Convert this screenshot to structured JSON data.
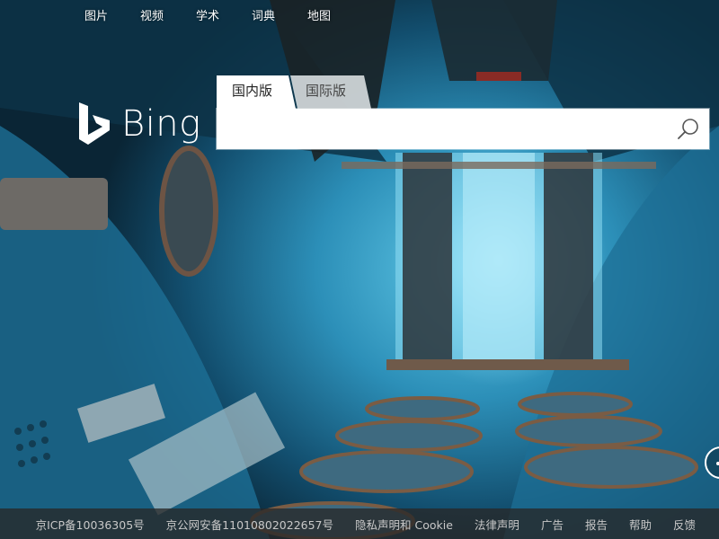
{
  "nav": {
    "items": [
      "图片",
      "视频",
      "学术",
      "词典",
      "地图"
    ]
  },
  "logo": {
    "text": "Bing"
  },
  "search": {
    "tabs": [
      "国内版",
      "国际版"
    ],
    "active_tab": "国内版",
    "value": "",
    "placeholder": ""
  },
  "footer": {
    "links": [
      "京ICP备10036305号",
      "京公网安备11010802022657号",
      "隐私声明和 Cookie",
      "法律声明",
      "广告",
      "报告",
      "帮助",
      "反馈"
    ]
  },
  "icons": {
    "search": "search-icon",
    "logo_mark": "bing-logo-icon"
  },
  "colors": {
    "footer_bg": "#282828",
    "footer_text": "#c8c8c8",
    "background_accent": "#2c8fb8"
  }
}
